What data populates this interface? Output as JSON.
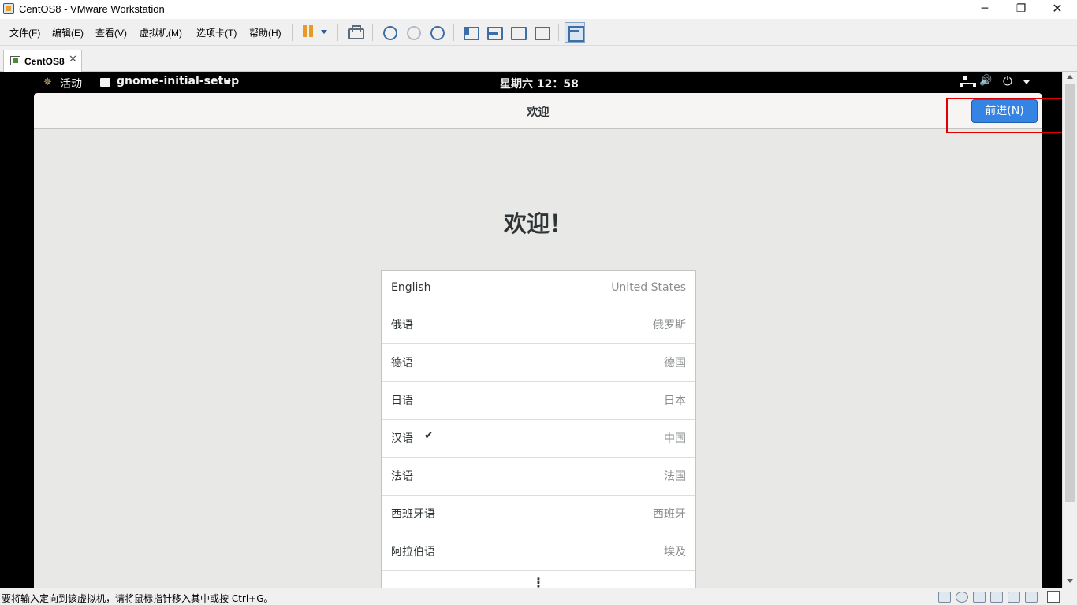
{
  "window": {
    "title": "CentOS8 - VMware Workstation",
    "minimize_glyph": "─",
    "restore_glyph": "❐",
    "close_glyph": "✕"
  },
  "menu": {
    "items": [
      "文件(F)",
      "编辑(E)",
      "查看(V)",
      "虚拟机(M)",
      "选项卡(T)",
      "帮助(H)"
    ]
  },
  "tab": {
    "label": "CentOS8",
    "close_glyph": "✕"
  },
  "gnome_topbar": {
    "activities_glyph": "✵",
    "activities": "活动",
    "app_menu": "gnome-initial-setup",
    "clock": "星期六 12：58",
    "volume_glyph": "🔊",
    "power_glyph": "⏻"
  },
  "setup": {
    "header_title": "欢迎",
    "next_button": "前进(N)",
    "welcome_heading": "欢迎！",
    "languages": [
      {
        "name": "English",
        "region": "United States",
        "selected": false
      },
      {
        "name": "俄语",
        "region": "俄罗斯",
        "selected": false
      },
      {
        "name": "德语",
        "region": "德国",
        "selected": false
      },
      {
        "name": "日语",
        "region": "日本",
        "selected": false
      },
      {
        "name": "汉语",
        "region": "中国",
        "selected": true
      },
      {
        "name": "法语",
        "region": "法国",
        "selected": false
      },
      {
        "name": "西班牙语",
        "region": "西班牙",
        "selected": false
      },
      {
        "name": "阿拉伯语",
        "region": "埃及",
        "selected": false
      }
    ],
    "check_glyph": "✔",
    "more_glyph": "⋮"
  },
  "statusbar": {
    "text": "要将输入定向到该虚拟机，请将鼠标指针移入其中或按 Ctrl+G。"
  },
  "colors": {
    "accent_button": "#3584e4",
    "highlight": "#e00000",
    "pause_icon": "#e89a28"
  }
}
